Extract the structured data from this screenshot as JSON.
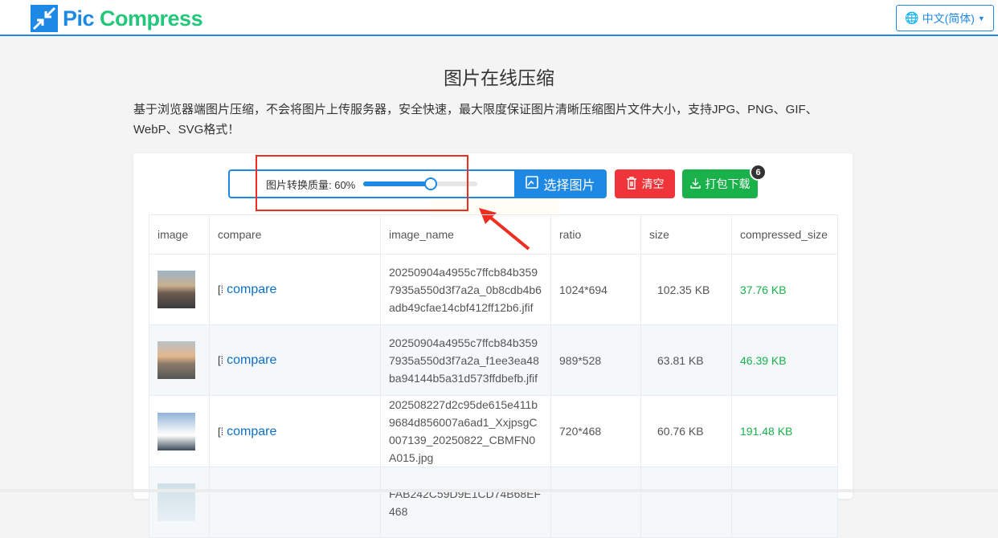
{
  "header": {
    "logo_part1": "Pic",
    "logo_part2": "Compress",
    "language": "中文(简体)"
  },
  "main": {
    "title": "图片在线压缩",
    "description": "基于浏览器端图片压缩，不会将图片上传服务器，安全快速，最大限度保证图片清晰压缩图片文件大小，支持JPG、PNG、GIF、WebP、SVG格式！",
    "quality_label": "图片转换质量: 60%",
    "quality_value": 60,
    "select_button": "选择图片",
    "clear_button": "清空",
    "download_button": "打包下载",
    "file_count": "6",
    "colors": {
      "accent": "#1e88e5",
      "danger": "#f0353a",
      "success": "#18b14a",
      "annotation": "#f02d1e"
    }
  },
  "table": {
    "headers": [
      "image",
      "compare",
      "image_name",
      "ratio",
      "size",
      "compressed_size"
    ],
    "rows": [
      {
        "compare": "compare",
        "name": "20250904a4955c7ffcb84b3597935a550d3f7a2a_0b8cdb4b6adb49cfae14cbf412ff12b6.jfif",
        "ratio": "1024*694",
        "size": "102.35 KB",
        "compressed": "37.76 KB"
      },
      {
        "compare": "compare",
        "name": "20250904a4955c7ffcb84b3597935a550d3f7a2a_f1ee3ea48ba94144b5a31d573ffdbefb.jfif",
        "ratio": "989*528",
        "size": "63.81 KB",
        "compressed": "46.39 KB"
      },
      {
        "compare": "compare",
        "name": "202508227d2c95de615e411b9684d856007a6ad1_XxjpsgC007139_20250822_CBMFN0A015.jpg",
        "ratio": "720*468",
        "size": "60.76 KB",
        "compressed": "191.48 KB"
      },
      {
        "compare": "",
        "name": "FAB242C59D9E1CD74B68EF468",
        "ratio": "",
        "size": "",
        "compressed": ""
      }
    ]
  }
}
